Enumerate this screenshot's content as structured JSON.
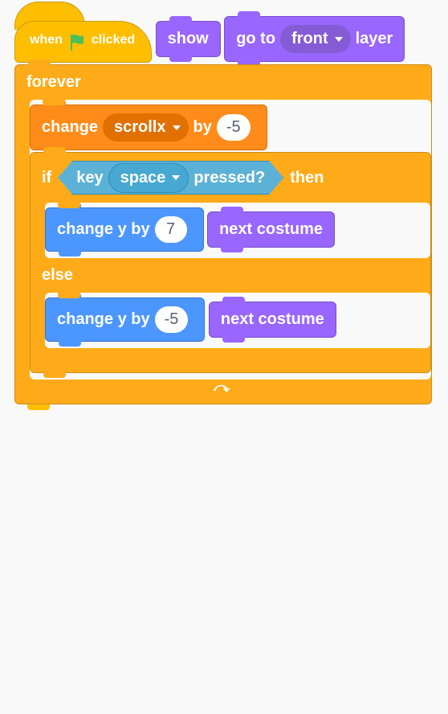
{
  "hat": {
    "when": "when",
    "clicked": "clicked",
    "iconName": "green-flag-icon"
  },
  "looks": {
    "show": "show",
    "goto_pre": "go to",
    "goto_dd": "front",
    "goto_post": "layer",
    "next_costume": "next costume"
  },
  "control": {
    "forever": "forever",
    "if": "if",
    "then": "then",
    "else": "else"
  },
  "data": {
    "change_pre": "change",
    "var_name": "scrollx",
    "by": "by",
    "change_val": "-5"
  },
  "sensing": {
    "key_pre": "key",
    "key_name": "space",
    "pressed": "pressed?"
  },
  "motion": {
    "change_y_by": "change y by",
    "val_up": "7",
    "val_down": "-5"
  }
}
